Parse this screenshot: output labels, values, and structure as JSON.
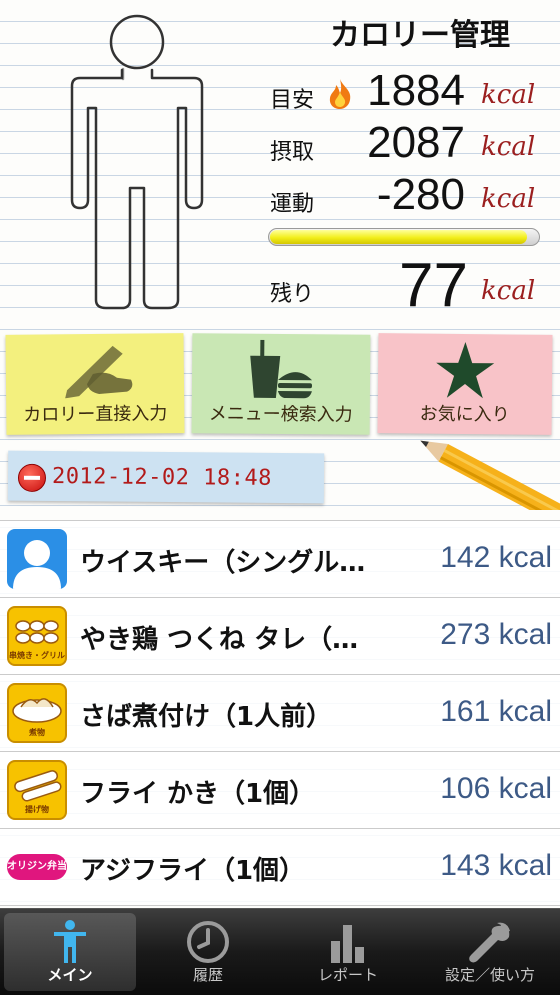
{
  "header": {
    "title": "カロリー管理",
    "target": {
      "label": "目安",
      "value": "1884",
      "unit": "kcal"
    },
    "intake": {
      "label": "摂取",
      "value": "2087",
      "unit": "kcal"
    },
    "exercise": {
      "label": "運動",
      "value": "-280",
      "unit": "kcal"
    },
    "remaining": {
      "label": "残り",
      "value": "77",
      "unit": "kcal"
    },
    "progress_fraction": 0.96
  },
  "notes": {
    "direct_input": "カロリー直接入力",
    "menu_search": "メニュー検索入力",
    "favorites": "お気に入り"
  },
  "date_tag": {
    "text": "2012-12-02 18:48"
  },
  "meals": [
    {
      "name": "ウイスキー（シングル…",
      "kcal": "142 kcal",
      "icon": "user-silhouette-icon"
    },
    {
      "name": "やき鶏 つくね タレ（…",
      "kcal": "273 kcal",
      "icon": "yakitori-category-icon",
      "icon_caption": "串焼き・グリル"
    },
    {
      "name": "さば煮付け（1人前）",
      "kcal": "161 kcal",
      "icon": "simmered-category-icon",
      "icon_caption": "煮物"
    },
    {
      "name": "フライ かき（1個）",
      "kcal": "106 kcal",
      "icon": "fried-category-icon",
      "icon_caption": "揚げ物"
    },
    {
      "name": "アジフライ（1個）",
      "kcal": "143 kcal",
      "icon": "brand-logo-icon",
      "icon_caption": "オリジン弁当"
    }
  ],
  "tabs": [
    {
      "label": "メイン",
      "icon": "person-icon",
      "active": true
    },
    {
      "label": "履歴",
      "icon": "clock-icon",
      "active": false
    },
    {
      "label": "レポート",
      "icon": "bar-chart-icon",
      "active": false
    },
    {
      "label": "設定／使い方",
      "icon": "wrench-icon",
      "active": false
    }
  ],
  "colors": {
    "accent_unit": "#9b1f1f",
    "kcal_text": "#3d5a86",
    "date_text": "#b21a1a",
    "progress": "#f2ee1a"
  }
}
